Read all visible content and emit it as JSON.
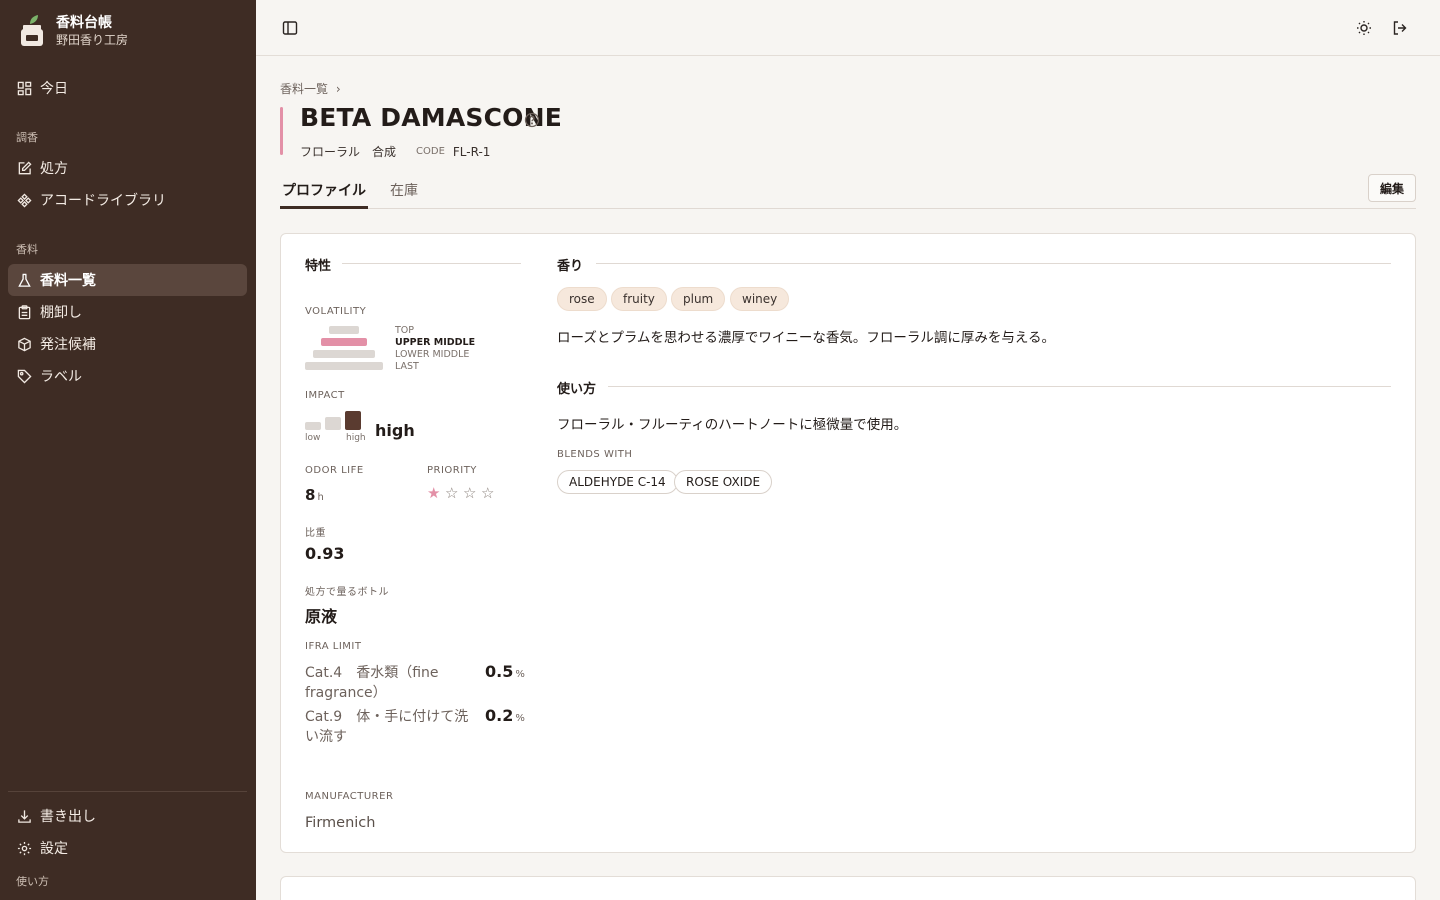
{
  "brand": {
    "title": "香料台帳",
    "subtitle": "野田香り工房"
  },
  "sidebar": {
    "today": "今日",
    "section_blending": "調香",
    "formulas": "処方",
    "accord_library": "アコードライブラリ",
    "section_materials": "香料",
    "material_list": "香料一覧",
    "stocktake": "棚卸し",
    "order_candidates": "発注候補",
    "labels": "ラベル",
    "export": "書き出し",
    "settings": "設定",
    "howto": "使い方"
  },
  "breadcrumb": {
    "parent": "香料一覧",
    "sep": "›"
  },
  "material": {
    "name": "BETA DAMASCONE",
    "family": "フローラル",
    "type": "合成",
    "code_label": "CODE",
    "code": "FL-R-1",
    "accent_color": "#e390a7"
  },
  "tabs": {
    "profile": "プロファイル",
    "stock": "在庫",
    "edit": "編集"
  },
  "properties": {
    "heading": "特性",
    "volatility_label": "VOLATILITY",
    "volatility_levels": [
      "TOP",
      "UPPER MIDDLE",
      "LOWER MIDDLE",
      "LAST"
    ],
    "volatility_selected": "UPPER MIDDLE",
    "impact_label": "IMPACT",
    "impact_low": "low",
    "impact_high": "high",
    "impact_value": "high",
    "odor_life_label": "ODOR LIFE",
    "odor_life_value": "8",
    "odor_life_unit": "h",
    "priority_label": "PRIORITY",
    "priority_value": 1,
    "priority_max": 4,
    "sg_label": "比重",
    "sg_value": "0.93",
    "bottle_label": "処方で量るボトル",
    "bottle_value": "原液",
    "ifra_label": "IFRA LIMIT",
    "ifra": [
      {
        "category": "Cat.4　香水類（fine fragrance）",
        "value": "0.5",
        "unit": "%"
      },
      {
        "category": "Cat.9　体・手に付けて洗い流す",
        "value": "0.2",
        "unit": "%"
      }
    ],
    "manufacturer_label": "MANUFACTURER",
    "manufacturer_value": "Firmenich"
  },
  "scent": {
    "heading": "香り",
    "tags": [
      "rose",
      "fruity",
      "plum",
      "winey"
    ],
    "description": "ローズとプラムを思わせる濃厚でワイニーな香気。フローラル調に厚みを与える。"
  },
  "usage": {
    "heading": "使い方",
    "text": "フローラル・フルーティのハートノートに極微量で使用。",
    "blends_label": "BLENDS WITH",
    "blends": [
      "ALDEHYDE C-14",
      "ROSE OXIDE"
    ]
  },
  "colors": {
    "sidebar_bg": "#3e2c24",
    "accent_pink": "#e390a7",
    "tag_bg": "#f6e8dc"
  }
}
